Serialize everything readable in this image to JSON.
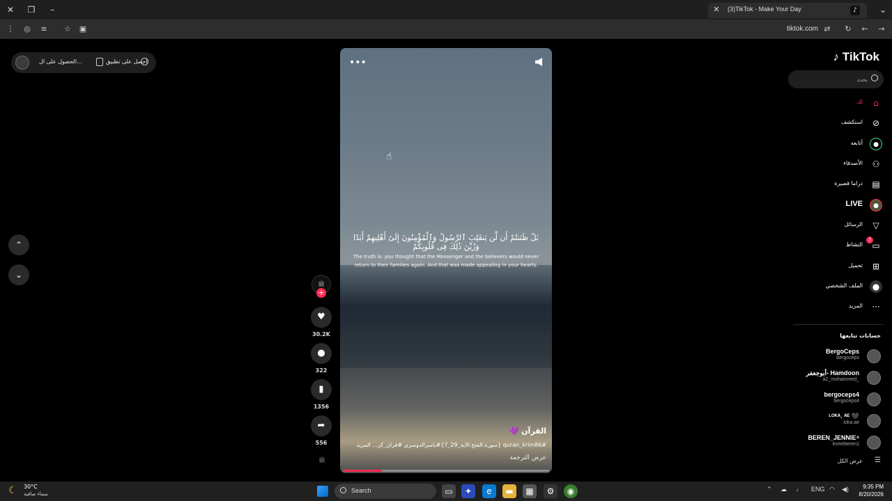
{
  "browser": {
    "tab_title": "(3)TikTok - Make Your Day",
    "url": "tiktok.com"
  },
  "top_pill": {
    "get_app": "احصل على تطبيق",
    "get_coins": "الحصول على ال..."
  },
  "video": {
    "arabic_verse": "بَلْ ظَنَنتُمْ أَن لَّن يَنقَلِبَ ٱلرَّسُولُ وَٱلْمُؤْمِنُونَ إِلَىٰٓ أَهْلِيهِمْ أَبَدًا وَزُيِّنَ ذَٰلِكَ فِى قُلُوبِكُمْ",
    "english_translation": "The truth is: you thought that the Messenger and the believers would never return to their families again. And that was made appealing in your hearts.",
    "caption_title": "القرآن 💜",
    "caption_tags": "#quran_krim86 {سورة.الفتح.الاية_29_7}#ياسرالدوسري #قران_كر... المزيد",
    "see_translation": "عرض الترجمة",
    "progress": 0.19
  },
  "actions": {
    "likes": "30.2K",
    "comments": "322",
    "saves": "1356",
    "shares": "556"
  },
  "sidebar": {
    "logo": "TikTok",
    "search_placeholder": "بحث",
    "nav": [
      {
        "label": "لك",
        "icon": "home-icon"
      },
      {
        "label": "استكشف",
        "icon": "compass-icon"
      },
      {
        "label": "أتابعه",
        "icon": "following-icon"
      },
      {
        "label": "الأصدقاء",
        "icon": "friends-icon"
      },
      {
        "label": "دراما قصيرة",
        "icon": "drama-icon"
      },
      {
        "label": "LIVE",
        "icon": "live-icon"
      },
      {
        "label": "الرسائل",
        "icon": "messages-icon"
      },
      {
        "label": "النشاط",
        "icon": "activity-icon",
        "badge": "3"
      },
      {
        "label": "تحميل",
        "icon": "upload-icon"
      },
      {
        "label": "الملف الشخصي",
        "icon": "profile-icon"
      },
      {
        "label": "المزيد",
        "icon": "more-icon"
      }
    ],
    "following_title": "حسابات تتابعها",
    "accounts": [
      {
        "name": "BergoCeps",
        "handle": "bergoceps"
      },
      {
        "name": "أبوجعفر- Hamdoon",
        "handle": "a2_mohammed_"
      },
      {
        "name": "bergoceps4",
        "handle": "bergoceps4"
      },
      {
        "name": "ᴸᴼᴷᴬ. ᴬᴱ 🖤",
        "handle": "loka.ae"
      },
      {
        "name": "BEREN_JENNIE⁴",
        "handle": "itsmeberen1"
      }
    ],
    "see_all": "عرض الكل"
  },
  "taskbar": {
    "temp": "30°C",
    "condition": "سماء صافية",
    "search": "Search",
    "lang": "ENG",
    "time": "9:35 PM",
    "date": "8/20/2026"
  },
  "colors": {
    "accent": "#fe2c55",
    "background": "#000000"
  }
}
